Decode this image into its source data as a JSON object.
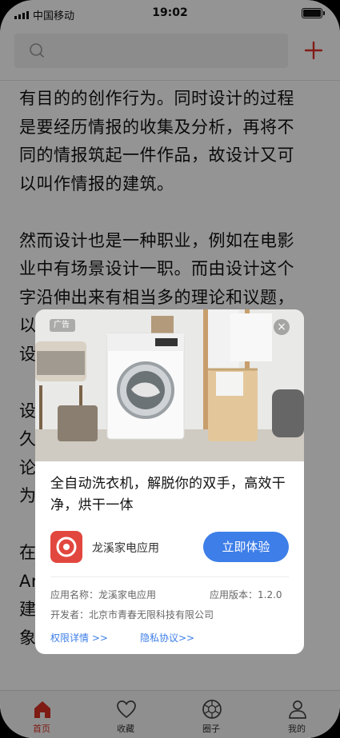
{
  "status_bar": {
    "carrier": "中国移动",
    "time": "19:02"
  },
  "search": {
    "placeholder": "",
    "value": ""
  },
  "article": {
    "paragraphs": [
      "有目的的创作行为。同时设计的过程\n是要经历情报的收集及分析，再将不\n同的情报筑起一件作品，故设计又可\n以叫作情报的建筑。",
      "然而设计也是一种职业，例如在电影\n业中有场景设计一职。而由设计这个\n字沿伸出来有相当多的理论和议题，\n以                                                    故\n设",
      "设\n久\n论                                                    计\n为",
      "在\nAr\n建                                                    由\n象"
    ]
  },
  "ad": {
    "badge": "广告",
    "close_symbol": "×",
    "title": "全自动洗衣机，解脱你的双手，高效干净，烘干一体",
    "app_name": "龙溪家电应用",
    "cta_label": "立即体验",
    "app_name_field": "应用名称：龙溪家电应用",
    "app_version_field": "应用版本：1.2.0",
    "developer_field": "开发者：北京市青春无限科技有限公司",
    "permissions_link": "权限详情 >>",
    "privacy_link": "隐私协议>>",
    "accent_color": "#3d7ee8",
    "icon_color": "#e2473f"
  },
  "tabbar": {
    "items": [
      {
        "label": "首页",
        "icon": "home-icon",
        "active": true
      },
      {
        "label": "收藏",
        "icon": "heart-icon",
        "active": false
      },
      {
        "label": "圈子",
        "icon": "aperture-icon",
        "active": false
      },
      {
        "label": "我的",
        "icon": "person-icon",
        "active": false
      }
    ]
  },
  "colors": {
    "brand_red": "#d93025",
    "overlay": "rgba(0,0,0,0.42)"
  }
}
